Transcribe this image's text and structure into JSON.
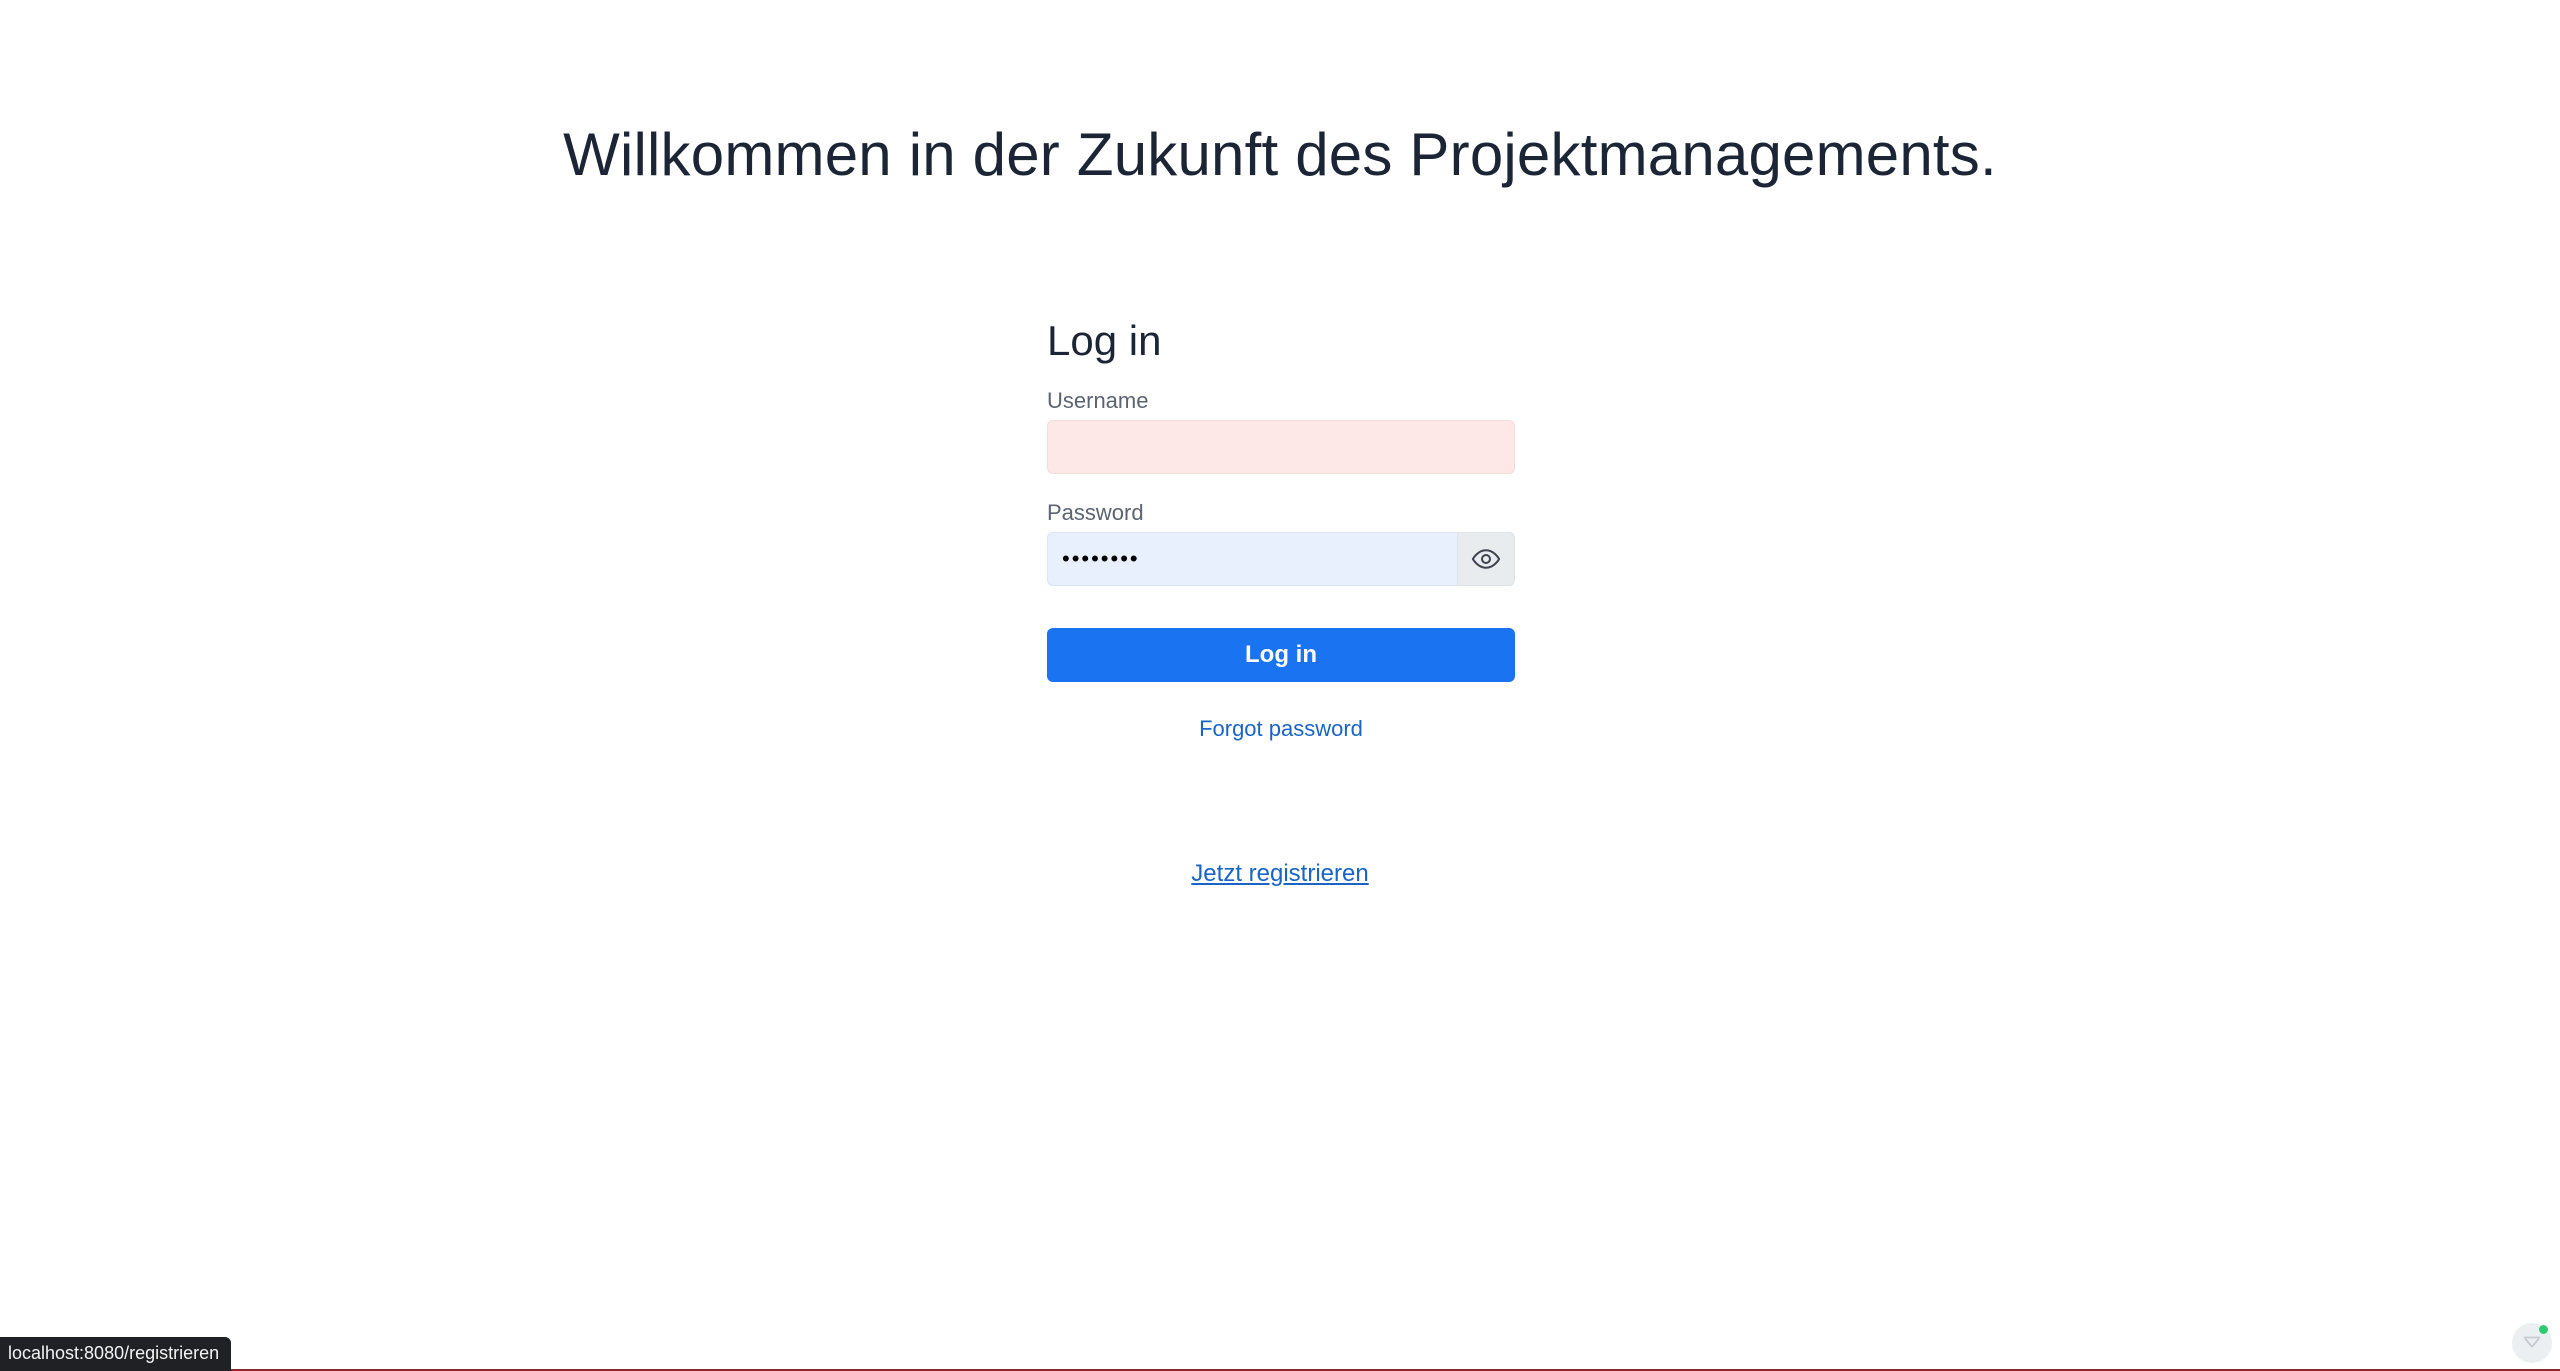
{
  "header": {
    "welcome_text": "Willkommen in der Zukunft des Projektmanagements."
  },
  "login": {
    "title": "Log in",
    "username_label": "Username",
    "username_value": "",
    "password_label": "Password",
    "password_value": "••••••••",
    "submit_label": "Log in",
    "forgot_label": "Forgot password"
  },
  "register": {
    "link_label": "Jetzt registrieren"
  },
  "status_bar": {
    "url": "localhost:8080/registrieren"
  },
  "colors": {
    "primary": "#1a73f0",
    "link": "#1a63c7",
    "username_bg": "#fde7e7",
    "password_bg": "#e8f0fe"
  },
  "icons": {
    "password_toggle": "eye-icon",
    "extension": "extension-icon"
  }
}
